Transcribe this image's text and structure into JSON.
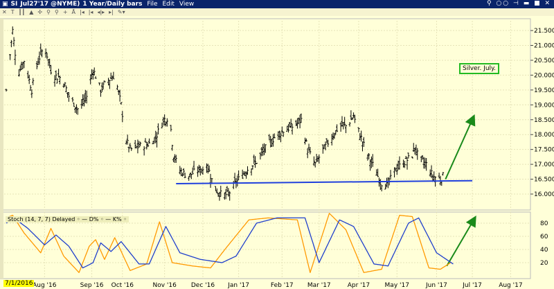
{
  "window": {
    "symbol": "SI",
    "contract": "Jul27'17 @NYME)",
    "period": "1 Year/Daily bars",
    "menus": [
      "File",
      "Edit",
      "View"
    ],
    "controls": "⚲ ○○ ⊣ ▬ ■ ✕"
  },
  "toolbar": {
    "icons": [
      "close-icon",
      "text-icon",
      "bars-icon",
      "mountain-icon",
      "crosshair-icon",
      "zoom-in-icon",
      "zoom-out-icon",
      "plus-icon",
      "scale-icon",
      "scroll-left-icon",
      "scroll-start-icon",
      "expand-icon",
      "scroll-right-icon",
      "draw-icon"
    ]
  },
  "note": "Silver. July.",
  "stoch_label": "Stoch  (14, 7, 7) Delayed ◦  — D% ◦  — K% ◦",
  "start_date": "7/1/2016",
  "colors": {
    "bars": "#000000",
    "support": "#1f3fdd",
    "arrow": "#1a8a1a",
    "d_line": "#1f3fcc",
    "k_line": "#ff9900"
  },
  "chart_data": [
    {
      "type": "ohlc",
      "title": "SI Jul27'17 Daily",
      "x_unit": "days since 7/1/2016",
      "y_ticks": [
        "21.500",
        "21.000",
        "20.500",
        "20.000",
        "19.500",
        "19.000",
        "18.500",
        "18.000",
        "17.500",
        "17.000",
        "16.500",
        "16.000"
      ],
      "ylim": [
        15.75,
        21.85
      ],
      "x_ticks": [
        {
          "label": "Aug '16",
          "day": 30
        },
        {
          "label": "Sep '16",
          "day": 67
        },
        {
          "label": "Oct '16",
          "day": 91
        },
        {
          "label": "Nov '16",
          "day": 124
        },
        {
          "label": "Dec '16",
          "day": 154
        },
        {
          "label": "Jan '17",
          "day": 182
        },
        {
          "label": "Feb '17",
          "day": 216
        },
        {
          "label": "Mar '17",
          "day": 245
        },
        {
          "label": "Apr '17",
          "day": 276
        },
        {
          "label": "May '17",
          "day": 306
        },
        {
          "label": "Jun '17",
          "day": 337
        },
        {
          "label": "Jul '17",
          "day": 365
        },
        {
          "label": "Aug '17",
          "day": 395
        }
      ],
      "close_path": [
        [
          0,
          19.5
        ],
        [
          5,
          21.5
        ],
        [
          9,
          20.0
        ],
        [
          14,
          20.5
        ],
        [
          20,
          19.5
        ],
        [
          25,
          20.5
        ],
        [
          30,
          21.0
        ],
        [
          36,
          20.0
        ],
        [
          44,
          19.9
        ],
        [
          49,
          19.3
        ],
        [
          57,
          18.8
        ],
        [
          63,
          19.3
        ],
        [
          68,
          20.2
        ],
        [
          74,
          19.5
        ],
        [
          79,
          19.8
        ],
        [
          85,
          20.0
        ],
        [
          90,
          19.0
        ],
        [
          94,
          17.8
        ],
        [
          97,
          17.5
        ],
        [
          104,
          17.6
        ],
        [
          112,
          17.7
        ],
        [
          117,
          17.9
        ],
        [
          123,
          18.5
        ],
        [
          128,
          18.6
        ],
        [
          131,
          17.3
        ],
        [
          136,
          16.8
        ],
        [
          142,
          16.6
        ],
        [
          150,
          16.8
        ],
        [
          158,
          16.9
        ],
        [
          163,
          16.2
        ],
        [
          169,
          15.95
        ],
        [
          174,
          16.0
        ],
        [
          180,
          16.4
        ],
        [
          188,
          16.8
        ],
        [
          196,
          17.1
        ],
        [
          204,
          17.6
        ],
        [
          212,
          18.0
        ],
        [
          220,
          18.2
        ],
        [
          226,
          18.3
        ],
        [
          231,
          18.5
        ],
        [
          236,
          17.5
        ],
        [
          242,
          17.0
        ],
        [
          247,
          17.4
        ],
        [
          253,
          17.8
        ],
        [
          261,
          18.3
        ],
        [
          266,
          18.3
        ],
        [
          272,
          18.6
        ],
        [
          277,
          18.0
        ],
        [
          283,
          17.3
        ],
        [
          288,
          16.9
        ],
        [
          293,
          16.4
        ],
        [
          299,
          16.3
        ],
        [
          304,
          16.8
        ],
        [
          310,
          17.0
        ],
        [
          318,
          17.3
        ],
        [
          320,
          17.6
        ],
        [
          323,
          17.2
        ],
        [
          329,
          17.0
        ],
        [
          334,
          16.6
        ],
        [
          340,
          16.5
        ],
        [
          342,
          16.6
        ]
      ],
      "support_line": [
        [
          133,
          16.35
        ],
        [
          365,
          16.45
        ]
      ],
      "arrow": [
        [
          344,
          16.5
        ],
        [
          366,
          18.6
        ]
      ]
    },
    {
      "type": "line",
      "title": "Stoch (14, 7, 7)",
      "y_ticks": [
        "80",
        "60",
        "40",
        "20"
      ],
      "ylim": [
        0,
        100
      ],
      "series": [
        {
          "name": "D%",
          "points": [
            [
              0,
              80
            ],
            [
              6,
              88
            ],
            [
              17,
              72
            ],
            [
              30,
              47
            ],
            [
              39,
              62
            ],
            [
              49,
              45
            ],
            [
              60,
              12
            ],
            [
              68,
              20
            ],
            [
              74,
              50
            ],
            [
              82,
              37
            ],
            [
              90,
              52
            ],
            [
              104,
              18
            ],
            [
              112,
              18
            ],
            [
              125,
              75
            ],
            [
              136,
              35
            ],
            [
              152,
              25
            ],
            [
              169,
              20
            ],
            [
              180,
              30
            ],
            [
              196,
              80
            ],
            [
              212,
              88
            ],
            [
              234,
              88
            ],
            [
              245,
              20
            ],
            [
              261,
              85
            ],
            [
              272,
              75
            ],
            [
              288,
              18
            ],
            [
              299,
              15
            ],
            [
              315,
              80
            ],
            [
              323,
              88
            ],
            [
              337,
              35
            ],
            [
              350,
              18
            ]
          ]
        },
        {
          "name": "K%",
          "points": [
            [
              0,
              88
            ],
            [
              5,
              92
            ],
            [
              14,
              65
            ],
            [
              27,
              35
            ],
            [
              35,
              72
            ],
            [
              45,
              30
            ],
            [
              57,
              5
            ],
            [
              65,
              45
            ],
            [
              70,
              55
            ],
            [
              77,
              25
            ],
            [
              85,
              58
            ],
            [
              97,
              8
            ],
            [
              110,
              18
            ],
            [
              120,
              82
            ],
            [
              130,
              20
            ],
            [
              146,
              15
            ],
            [
              160,
              12
            ],
            [
              172,
              42
            ],
            [
              190,
              85
            ],
            [
              205,
              88
            ],
            [
              228,
              85
            ],
            [
              238,
              5
            ],
            [
              253,
              95
            ],
            [
              266,
              70
            ],
            [
              280,
              5
            ],
            [
              294,
              10
            ],
            [
              308,
              92
            ],
            [
              318,
              90
            ],
            [
              331,
              12
            ],
            [
              340,
              10
            ],
            [
              348,
              20
            ]
          ]
        }
      ],
      "arrow": [
        [
          345,
          15
        ],
        [
          367,
          88
        ]
      ]
    }
  ]
}
